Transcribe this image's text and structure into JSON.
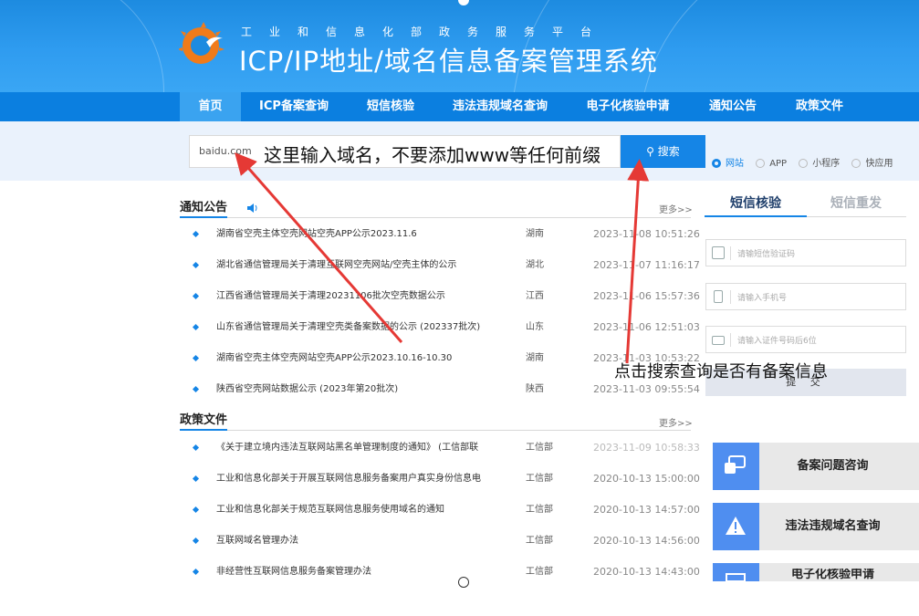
{
  "header": {
    "subtitle": "工业和信息化部政务服务平台",
    "title": "ICP/IP地址/域名信息备案管理系统"
  },
  "nav": {
    "items": [
      "首页",
      "ICP备案查询",
      "短信核验",
      "违法违规域名查询",
      "电子化核验申请",
      "通知公告",
      "政策文件"
    ],
    "active": "首页"
  },
  "search": {
    "value": "baidu.com",
    "button_label": "搜索",
    "annotation": "这里输入域名，不要添加www等任何前缀",
    "options": [
      "网站",
      "APP",
      "小程序",
      "快应用"
    ],
    "selected_option": "网站"
  },
  "notices": {
    "title": "通知公告",
    "more": "更多>>",
    "items": [
      {
        "title": "湖南省空壳主体空壳网站空壳APP公示2023.11.6",
        "region": "湖南",
        "date": "2023-11-08 10:51:26"
      },
      {
        "title": "湖北省通信管理局关于清理互联网空壳网站/空壳主体的公示",
        "region": "湖北",
        "date": "2023-11-07 11:16:17"
      },
      {
        "title": "江西省通信管理局关于清理20231106批次空壳数据公示",
        "region": "江西",
        "date": "2023-11-06 15:57:36"
      },
      {
        "title": "山东省通信管理局关于清理空壳类备案数据的公示 (202337批次)",
        "region": "山东",
        "date": "2023-11-06 12:51:03"
      },
      {
        "title": "湖南省空壳主体空壳网站空壳APP公示2023.10.16-10.30",
        "region": "湖南",
        "date": "2023-11-03 10:53:22"
      },
      {
        "title": "陕西省空壳网站数据公示 (2023年第20批次)",
        "region": "陕西",
        "date": "2023-11-03 09:55:54"
      }
    ]
  },
  "policies": {
    "title": "政策文件",
    "more": "更多>>",
    "items": [
      {
        "title": "《关于建立境内违法互联网站黑名单管理制度的通知》 (工信部联",
        "region": "工信部",
        "date": "2023-11-09 10:58:33"
      },
      {
        "title": "工业和信息化部关于开展互联网信息服务备案用户真实身份信息电",
        "region": "工信部",
        "date": "2020-10-13 15:00:00"
      },
      {
        "title": "工业和信息化部关于规范互联网信息服务使用域名的通知",
        "region": "工信部",
        "date": "2020-10-13 14:57:00"
      },
      {
        "title": "互联网域名管理办法",
        "region": "工信部",
        "date": "2020-10-13 14:56:00"
      },
      {
        "title": "非经营性互联网信息服务备案管理办法",
        "region": "工信部",
        "date": "2020-10-13 14:43:00"
      }
    ]
  },
  "sms_panel": {
    "tab_verify": "短信核验",
    "tab_resend": "短信重发",
    "code_placeholder": "请输短信验证码",
    "phone_placeholder": "请输入手机号",
    "id_placeholder": "请输入证件号码后6位",
    "submit_label": "提 交",
    "annotation": "点击搜索查询是否有备案信息"
  },
  "cards": [
    {
      "label": "备案问题咨询",
      "icon": "chat-icon"
    },
    {
      "label": "违法违规域名查询",
      "icon": "warning-icon"
    },
    {
      "label": "电子化核验申请",
      "icon": "document-icon"
    }
  ],
  "colors": {
    "primary": "#1585e6",
    "annotation_arrow": "#e53935"
  }
}
